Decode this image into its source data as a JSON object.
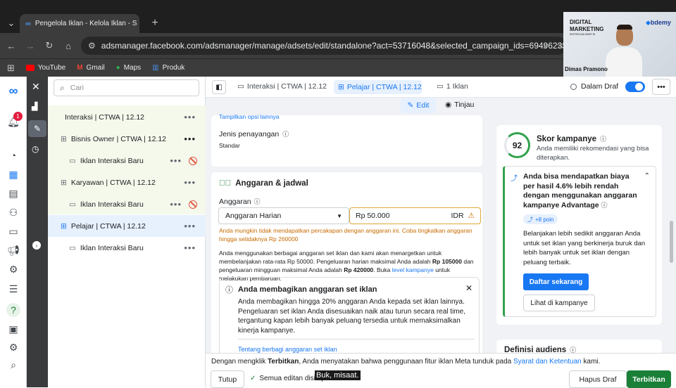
{
  "browser": {
    "tab_title": "Pengelola Iklan - Kelola Iklan - S",
    "url": "adsmanager.facebook.com/adsmanager/manage/adsets/edit/standalone?act=53716048&selected_campaign_ids=6949623320815...",
    "bookmarks": [
      "YouTube",
      "Gmail",
      "Maps",
      "Produk"
    ]
  },
  "webcam": {
    "brand_left_1": "DIGITAL",
    "brand_left_2": "MARKETING",
    "brand_left_3": "SERTIFIKASI BNSP RI",
    "brand_right": "bdemy",
    "presenter": "Dimas Pramono"
  },
  "rail": {
    "notification_count": "1"
  },
  "search": {
    "placeholder": "Cari"
  },
  "tree": {
    "campaign": "Interaksi | CTWA | 12.12",
    "adset1": "Bisnis Owner | CTWA | 12.12",
    "ad1": "Iklan Interaksi Baru",
    "adset2": "Karyawan | CTWA | 12.12",
    "ad2": "Iklan Interaksi Baru",
    "adset3": "Pelajar | CTWA | 12.12",
    "ad3": "Iklan Interaksi Baru"
  },
  "topbar": {
    "crumb_campaign": "Interaksi | CTWA | 12.12",
    "crumb_adset": "Pelajar | CTWA | 12.12",
    "crumb_ads": "1 Iklan",
    "status": "Dalam Draf",
    "edit": "Edit",
    "review": "Tinjau"
  },
  "placement": {
    "cut_text": "Tampilkan opsi lainnya",
    "title": "Jenis penayangan",
    "value": "Standar"
  },
  "budget": {
    "title": "Anggaran & jadwal",
    "label": "Anggaran",
    "type": "Anggaran Harian",
    "amount": "Rp 50.000",
    "currency": "IDR",
    "warning": "Anda mungkin tidak mendapatkan percakapan dengan anggaran ini. Coba tingkatkan anggaran hingga setidaknya Rp 260000",
    "desc_1": "Anda menggunakan berbagai anggaran set iklan dan kami akan menargetkan untuk membelanjakan rata-rata Rp 50000. Pengeluaran harian maksimal Anda adalah",
    "desc_max_daily": "Rp 105000",
    "desc_2": "dan pengeluaran mingguan maksimal Anda adalah",
    "desc_max_weekly": "Rp 420000",
    "desc_3": ". Buka",
    "desc_link": "level kampanye",
    "desc_4": "untuk melakukan pembaruan.",
    "info_title": "Anda membagikan anggaran set iklan",
    "info_body": "Anda membagikan hingga 20% anggaran Anda kepada set iklan lainnya. Pengeluaran set iklan Anda disesuaikan naik atau turun secara real time, tergantung kapan lebih banyak peluang tersedia untuk memaksimalkan kinerja kampanye.",
    "info_link": "Tentang berbagi anggaran set iklan"
  },
  "score": {
    "value": "92",
    "title": "Skor kampanye",
    "subtitle": "Anda memiliki rekomendasi yang bisa diterapkan.",
    "rec_title": "Anda bisa mendapatkan biaya per hasil 4.6% lebih rendah dengan menggunakan anggaran kampanye Advantage",
    "points": "+8 poin",
    "rec_body": "Belanjakan lebih sedikit anggaran Anda untuk set iklan yang berkinerja buruk dan lebih banyak untuk set iklan dengan peluang terbaik.",
    "btn_primary": "Daftar sekarang",
    "btn_secondary": "Lihat di kampanye",
    "next_section": "Definisi audiens"
  },
  "footer": {
    "notice_1": "Dengan mengklik",
    "notice_bold": "Terbitkan",
    "notice_2": ", Anda menyatakan bahwa penggunaan fitur iklan Meta tunduk pada",
    "notice_link": "Syarat dan Ketentuan",
    "notice_3": "kami.",
    "close": "Tutup",
    "saved": "Semua editan disimpan",
    "caption": "Buk, misaat.",
    "save_draft": "Hapus Draf",
    "publish": "Terbitkan"
  },
  "colors": {
    "brand": "#1877f2",
    "publish": "#1a7f37",
    "warning": "#c76b00",
    "tree_selected": "#e7f0fd",
    "tree_group": "#f5f9ec"
  }
}
